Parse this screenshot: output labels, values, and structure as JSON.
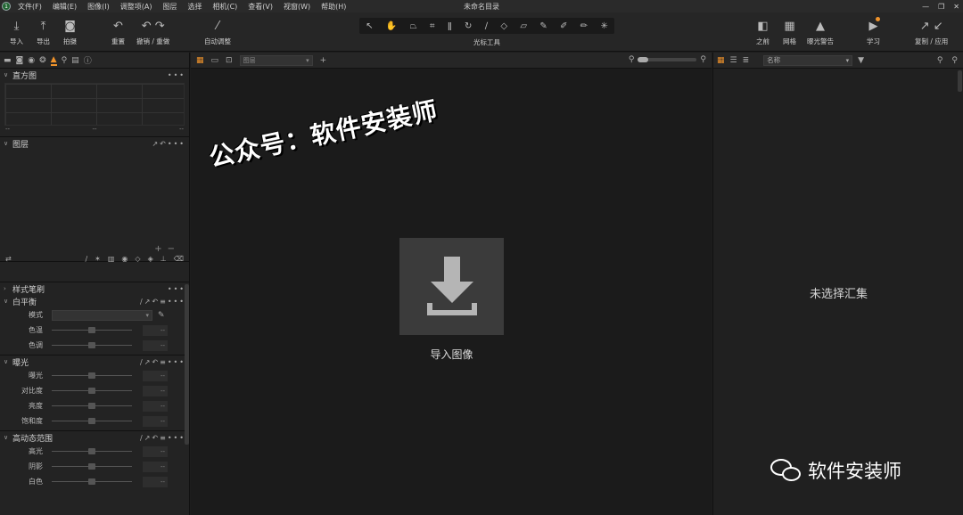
{
  "window": {
    "title": "未命名目录",
    "controls": [
      "—",
      "❐",
      "✕"
    ]
  },
  "menu": [
    "文件(F)",
    "编辑(E)",
    "图像(I)",
    "调整项(A)",
    "图层",
    "选择",
    "相机(C)",
    "查看(V)",
    "视窗(W)",
    "帮助(H)"
  ],
  "toolbar": {
    "import": "导入",
    "export": "导出",
    "capture": "拍摄",
    "reset": "重置",
    "undo_redo": "撤销 / 重做",
    "auto_adjust": "自动调整",
    "cursor_tools": "光标工具",
    "before": "之前",
    "grid": "网格",
    "exposure_warning": "曝光警告",
    "learn": "学习",
    "copy_apply": "复制 / 应用"
  },
  "left": {
    "histogram_title": "直方图",
    "hist_values": [
      "--",
      "--",
      "--"
    ],
    "layers_title": "图层",
    "style_brush_title": "样式笔刷",
    "white_balance": {
      "title": "白平衡",
      "mode_label": "模式",
      "temp_label": "色温",
      "tint_label": "色调",
      "val": "--"
    },
    "exposure": {
      "title": "曝光",
      "rows": [
        "曝光",
        "对比度",
        "亮度",
        "饱和度"
      ],
      "val": "--"
    },
    "hdr": {
      "title": "高动态范围",
      "rows": [
        "高光",
        "阴影",
        "白色"
      ],
      "val": "--"
    }
  },
  "center": {
    "layer_select": "图层",
    "import_label": "导入图像",
    "watermark": "公众号：软件安装师"
  },
  "right": {
    "sort_select": "名称",
    "empty_text": "未选择汇集",
    "wechat_text": "软件安装师"
  },
  "colors": {
    "accent": "#f0932b",
    "bg": "#1d1d1d"
  }
}
